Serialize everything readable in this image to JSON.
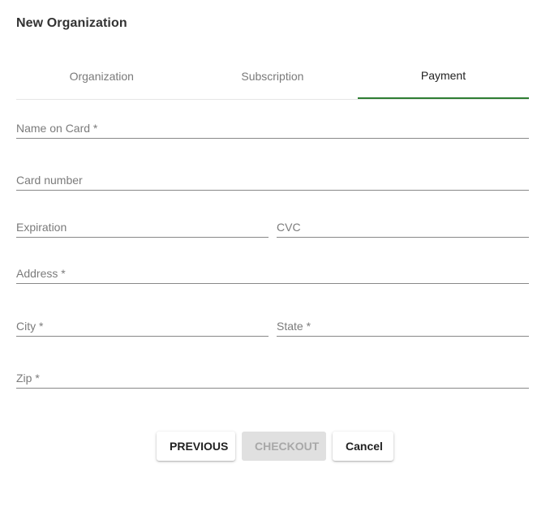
{
  "dialog": {
    "title": "New Organization"
  },
  "tabs": [
    {
      "label": "Organization",
      "active": false
    },
    {
      "label": "Subscription",
      "active": false
    },
    {
      "label": "Payment",
      "active": true
    }
  ],
  "form": {
    "name_on_card": {
      "label": "Name on Card *",
      "value": ""
    },
    "card_number": {
      "label": "Card number",
      "value": ""
    },
    "expiration": {
      "label": "Expiration",
      "value": ""
    },
    "cvc": {
      "label": "CVC",
      "value": ""
    },
    "address": {
      "label": "Address *",
      "value": ""
    },
    "city": {
      "label": "City *",
      "value": ""
    },
    "state": {
      "label": "State *",
      "value": ""
    },
    "zip": {
      "label": "Zip *",
      "value": ""
    }
  },
  "actions": {
    "previous_label": "PREVIOUS",
    "checkout_label": "CHECKOUT",
    "cancel_label": "Cancel"
  },
  "colors": {
    "active_tab_indicator": "#2e7d32",
    "disabled_button_bg": "#e0e0e0",
    "disabled_button_text": "#a8a8a8"
  }
}
